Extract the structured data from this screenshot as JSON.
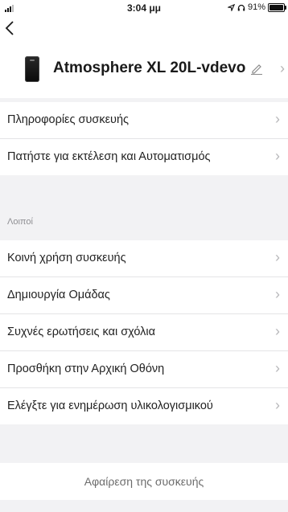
{
  "status_bar": {
    "time": "3:04 μμ",
    "battery": "91%"
  },
  "nav": {
    "back_icon": "chevron-left-icon"
  },
  "device": {
    "name": "Atmosphere XL 20L-vdevo"
  },
  "list1": [
    {
      "label": "Πληροφορίες συσκευής"
    },
    {
      "label": "Πατήστε για εκτέλεση και Αυτοματισμός"
    }
  ],
  "section": {
    "label": "Λοιποί"
  },
  "list2": [
    {
      "label": "Κοινή χρήση συσκευής"
    },
    {
      "label": "Δημιουργία Ομάδας"
    },
    {
      "label": "Συχνές ερωτήσεις και σχόλια"
    },
    {
      "label": "Προσθήκη στην Αρχική Οθόνη"
    },
    {
      "label": "Ελέγξτε για ενημέρωση υλικολογισμικού"
    }
  ],
  "remove": {
    "label": "Αφαίρεση της συσκευής"
  }
}
